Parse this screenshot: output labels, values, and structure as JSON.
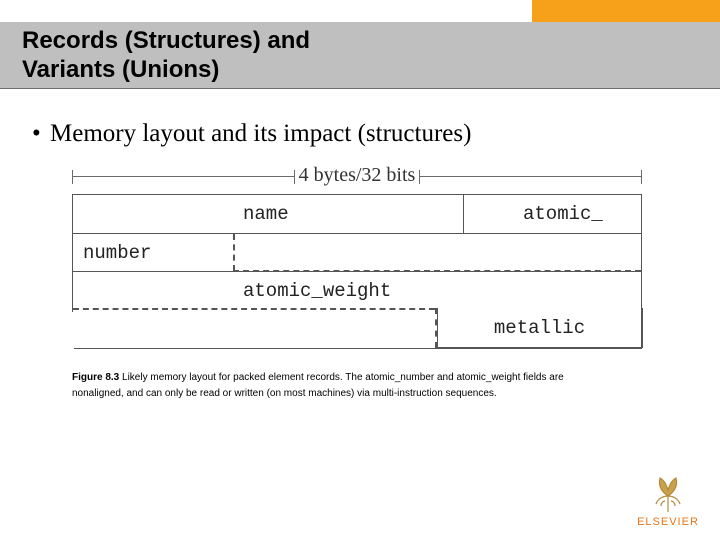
{
  "header": {
    "title_line1": "Records (Structures) and",
    "title_line2": "Variants (Unions)"
  },
  "bullet": {
    "text": "Memory layout and its impact (structures)"
  },
  "figure": {
    "width_label": "4 bytes/32 bits",
    "row1": {
      "left_label": "name",
      "right_label": "atomic_"
    },
    "row2": {
      "left_label": "number"
    },
    "row3": {
      "center_label": "atomic_weight"
    },
    "row4": {
      "right_label": "metallic"
    }
  },
  "caption": {
    "fig_no": "Figure 8.3",
    "body1": " Likely memory layout for packed element records. The atomic_number and atomic_weight fields are",
    "body2": "nonaligned, and can only be read or written (on most machines) via ",
    "body3": "multi-instruction sequences."
  },
  "brand": {
    "name": "ELSEVIER"
  },
  "colors": {
    "accent_orange": "#f7a11a",
    "title_grey": "#bfbfbf",
    "brand_orange": "#e77516"
  }
}
